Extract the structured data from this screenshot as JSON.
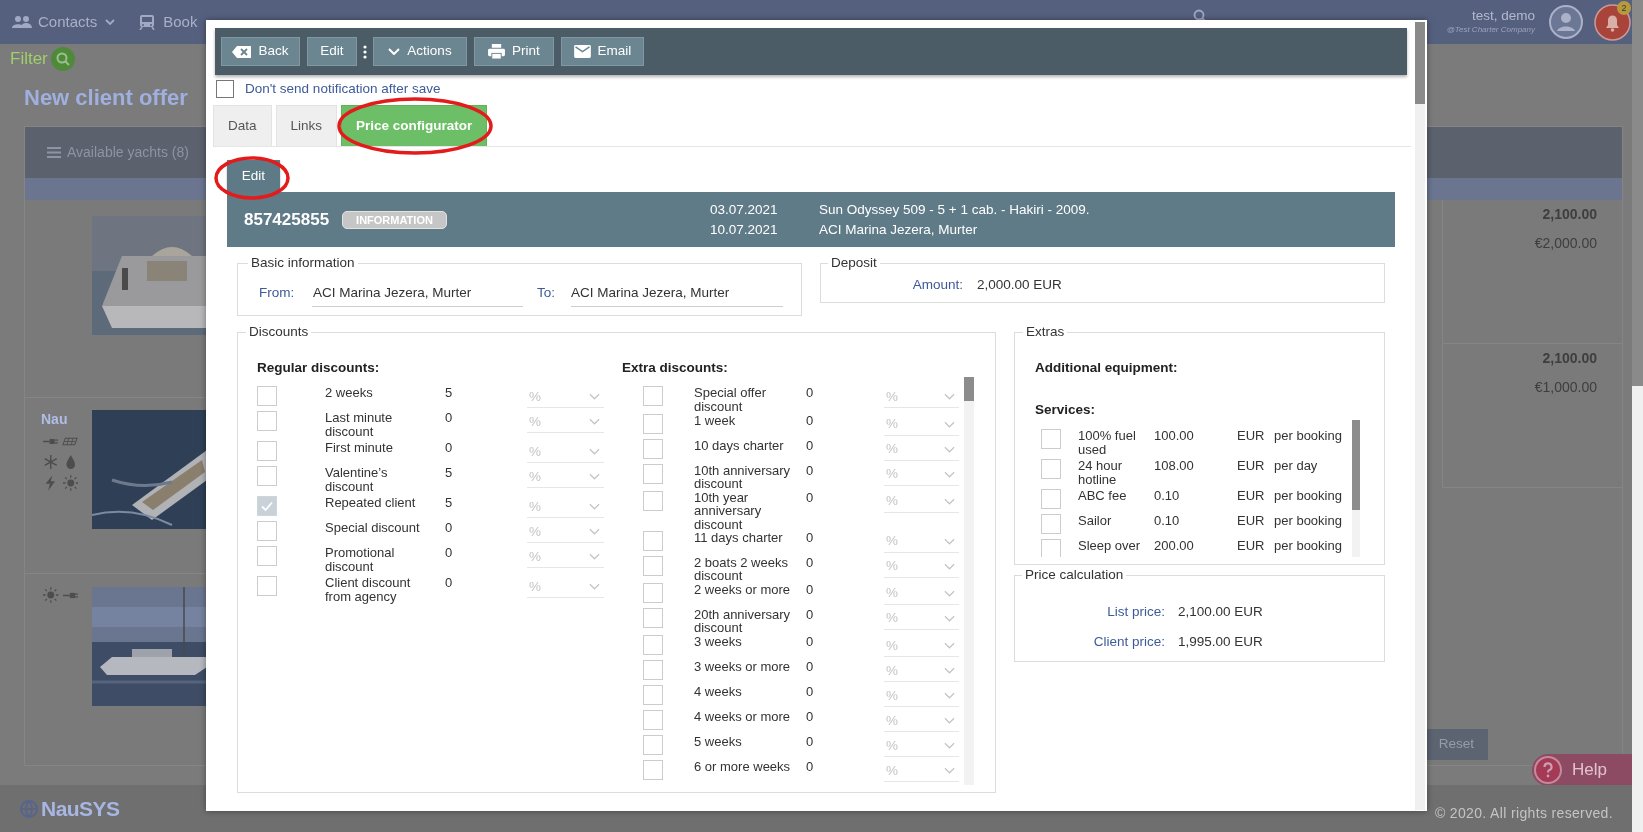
{
  "nav": {
    "items": [
      {
        "kind": "contacts",
        "label": "Contacts"
      },
      {
        "kind": "book",
        "label": "Book"
      }
    ],
    "user": {
      "name": "test, demo",
      "company": "@Test Charter Company"
    },
    "notifications": "2"
  },
  "page": {
    "filter": "Filter",
    "title": "New client offer",
    "yachts_tab": "Available yachts (8)",
    "yachts": [
      {
        "kind": "picture",
        "price": "2,100.00",
        "deposit": "€2,000.00"
      },
      {
        "kind": "picture",
        "logo": "Nau",
        "price": "2,100.00",
        "deposit": "€1,000.00"
      },
      {
        "kind": "picture"
      }
    ],
    "reset_button": "Reset",
    "help_button": "Help",
    "logo": "NauSYS",
    "footer": "© 2020. All rights reserved."
  },
  "modal": {
    "toolbar": [
      {
        "kind": "back",
        "label": "Back"
      },
      {
        "kind": "plain",
        "label": "Edit"
      },
      {
        "kind": "more"
      },
      {
        "kind": "actions",
        "label": "Actions"
      },
      {
        "kind": "print",
        "label": "Print"
      },
      {
        "kind": "email",
        "label": "Email"
      }
    ],
    "notify": {
      "label": "Don't send notification after save",
      "checked": false
    },
    "tabs": [
      {
        "label": "Data",
        "selected": false
      },
      {
        "label": "Links",
        "selected": false
      },
      {
        "label": "Price configurator",
        "selected": true
      }
    ],
    "edit_button": "Edit",
    "info": {
      "id": "857425855",
      "badge": "INFORMATION",
      "dates": [
        "03.07.2021",
        "10.07.2021"
      ],
      "details": [
        "Sun Odyssey 509 - 5 + 1 cab. - Hakiri - 2009.",
        "ACI Marina Jezera, Murter"
      ]
    },
    "basic": {
      "title": "Basic information",
      "from_label": "From:",
      "from": "ACI Marina Jezera, Murter",
      "to_label": "To:",
      "to": "ACI Marina Jezera, Murter"
    },
    "deposit": {
      "title": "Deposit",
      "label": "Amount:",
      "value": "2,000.00 EUR"
    },
    "discounts": {
      "title": "Discounts",
      "regular": {
        "title": "Regular discounts:",
        "items": [
          {
            "label": "2 weeks",
            "value": "5",
            "unit": "%",
            "checked": false
          },
          {
            "label": "Last minute discount",
            "value": "0",
            "unit": "%",
            "checked": false
          },
          {
            "label": "First minute",
            "value": "0",
            "unit": "%",
            "checked": false
          },
          {
            "label": "Valentine’s discount",
            "value": "5",
            "unit": "%",
            "checked": false
          },
          {
            "label": "Repeated client",
            "value": "5",
            "unit": "%",
            "checked": true
          },
          {
            "label": "Special discount",
            "value": "0",
            "unit": "%",
            "checked": false
          },
          {
            "label": "Promotional discount",
            "value": "0",
            "unit": "%",
            "checked": false
          },
          {
            "label": "Client discount from agency",
            "value": "0",
            "unit": "%",
            "checked": false
          }
        ]
      },
      "extra": {
        "title": "Extra discounts:",
        "items": [
          {
            "label": "Special offer discount",
            "value": "0",
            "unit": "%",
            "checked": false
          },
          {
            "label": "1 week",
            "value": "0",
            "unit": "%",
            "checked": false
          },
          {
            "label": "10 days charter",
            "value": "0",
            "unit": "%",
            "checked": false
          },
          {
            "label": "10th anniversary discount",
            "value": "0",
            "unit": "%",
            "checked": false
          },
          {
            "label": "10th year anniversary discount",
            "value": "0",
            "unit": "%",
            "checked": false
          },
          {
            "label": "11 days charter",
            "value": "0",
            "unit": "%",
            "checked": false
          },
          {
            "label": "2 boats 2 weeks discount",
            "value": "0",
            "unit": "%",
            "checked": false
          },
          {
            "label": "2 weeks or more",
            "value": "0",
            "unit": "%",
            "checked": false
          },
          {
            "label": "20th anniversary discount",
            "value": "0",
            "unit": "%",
            "checked": false
          },
          {
            "label": "3 weeks",
            "value": "0",
            "unit": "%",
            "checked": false
          },
          {
            "label": "3 weeks or more",
            "value": "0",
            "unit": "%",
            "checked": false
          },
          {
            "label": "4 weeks",
            "value": "0",
            "unit": "%",
            "checked": false
          },
          {
            "label": "4 weeks or more",
            "value": "0",
            "unit": "%",
            "checked": false
          },
          {
            "label": "5 weeks",
            "value": "0",
            "unit": "%",
            "checked": false
          },
          {
            "label": "6 or more weeks",
            "value": "0",
            "unit": "%",
            "checked": false
          }
        ]
      }
    },
    "extras": {
      "title": "Extras",
      "equipment_title": "Additional equipment:",
      "services_title": "Services:",
      "services": [
        {
          "label": "100% fuel used",
          "price": "100.00",
          "currency": "EUR",
          "period": "per booking",
          "checked": false
        },
        {
          "label": "24 hour hotline",
          "price": "108.00",
          "currency": "EUR",
          "period": "per day",
          "checked": false
        },
        {
          "label": "ABC fee",
          "price": "0.10",
          "currency": "EUR",
          "period": "per booking",
          "checked": false
        },
        {
          "label": "Sailor",
          "price": "0.10",
          "currency": "EUR",
          "period": "per booking",
          "checked": false
        },
        {
          "label": "Sleep over",
          "price": "200.00",
          "currency": "EUR",
          "period": "per booking",
          "checked": false
        }
      ]
    },
    "price_calc": {
      "title": "Price calculation",
      "rows": [
        {
          "label": "List price:",
          "value": "2,100.00 EUR"
        },
        {
          "label": "Client price:",
          "value": "1,995.00 EUR"
        }
      ]
    }
  }
}
